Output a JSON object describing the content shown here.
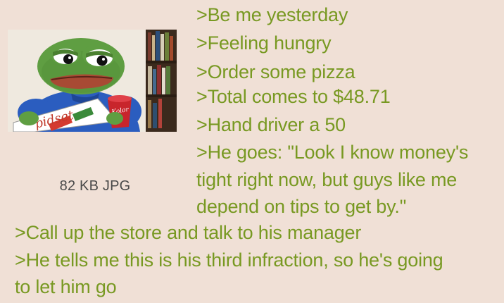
{
  "post": {
    "file_info": "82 KB JPG",
    "image": {
      "subject": "pepe-frog-with-pizza-box",
      "box_text": "pidset",
      "cup_text": "Kolor",
      "colors": {
        "skin": "#5f9e42",
        "shirt": "#2b5dbf",
        "box": "#ffffff",
        "cup": "#c8252c"
      }
    },
    "lines": [
      ">Be me yesterday",
      ">Feeling hungry",
      ">Order some pizza",
      ">Total comes to $48.71",
      ">Hand driver a 50",
      ">He goes: \"Look I know money's",
      "tight right now, but guys like me",
      "depend on tips to get by.\"",
      ">Call up the store and talk to his manager",
      ">He tells me this is his third infraction, so he's going",
      "to let him go"
    ]
  },
  "colors": {
    "background": "#f0e0d6",
    "greentext": "#789922",
    "meta_text": "#4a4a4a"
  }
}
